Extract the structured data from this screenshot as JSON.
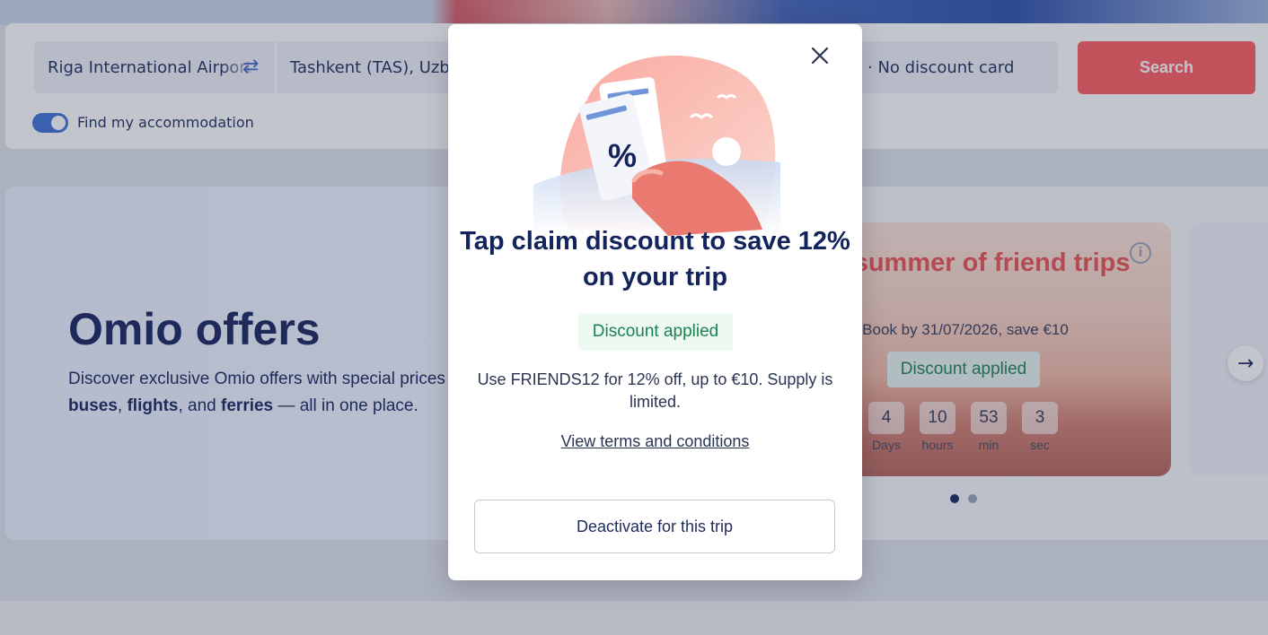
{
  "search": {
    "from_value": "Riga International Airport",
    "to_value": "Tashkent (TAS), Uzbekistan",
    "discount_card": "· No discount card",
    "search_label": "Search",
    "accommodation_label": "Find my accommodation",
    "accommodation_enabled": true
  },
  "offers": {
    "title": "Omio offers",
    "desc_line1": "Discover exclusive Omio offers with special prices on trains,",
    "desc_buses": "buses",
    "desc_sep1": ", ",
    "desc_flights": "flights",
    "desc_sep2": ", and ",
    "desc_ferries": "ferries",
    "desc_end": " — all in one place."
  },
  "promo": {
    "title": "e summer of friend trips",
    "subtitle": "Book by 31/07/2026, save €10",
    "badge": "Discount applied",
    "info_icon": "i",
    "countdown": [
      {
        "value": "4",
        "unit": "Days"
      },
      {
        "value": "10",
        "unit": "hours"
      },
      {
        "value": "53",
        "unit": "min"
      },
      {
        "value": "3",
        "unit": "sec"
      }
    ],
    "next_arrow": "→",
    "active_slide": 1,
    "total_slides": 2
  },
  "modal": {
    "title": "Tap claim discount to save 12% on your trip",
    "badge": "Discount applied",
    "description": "Use FRIENDS12 for 12% off, up to €10. Supply is limited.",
    "terms_link": "View terms and conditions",
    "deactivate_label": "Deactivate for this trip",
    "illustration_symbol": "%"
  },
  "colors": {
    "brand_red": "#fc5b5e",
    "navy": "#13235b",
    "success_green": "#1b8352",
    "toggle_blue": "#3b6fd4"
  },
  "icons": {
    "swap": "swap-icon",
    "close": "close-icon",
    "info": "info-icon",
    "next": "arrow-right-icon"
  }
}
